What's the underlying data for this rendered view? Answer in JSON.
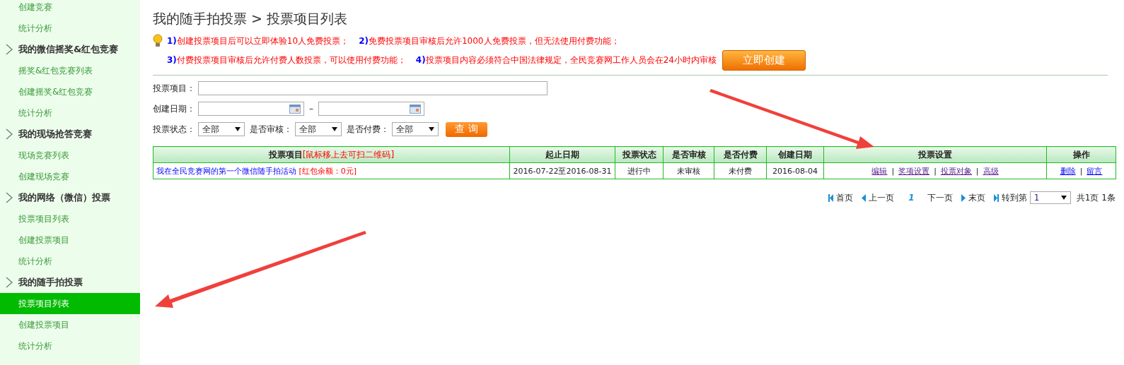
{
  "sidebar": {
    "items": [
      {
        "kind": "item",
        "label": "创建竞赛",
        "selected": false
      },
      {
        "kind": "item",
        "label": "统计分析",
        "selected": false
      },
      {
        "kind": "heading",
        "label": "我的微信摇奖&红包竞赛",
        "selected": false
      },
      {
        "kind": "item",
        "label": "摇奖&红包竞赛列表",
        "selected": false
      },
      {
        "kind": "item",
        "label": "创建摇奖&红包竞赛",
        "selected": false
      },
      {
        "kind": "item",
        "label": "统计分析",
        "selected": false
      },
      {
        "kind": "heading",
        "label": "我的现场抢答竞赛",
        "selected": false
      },
      {
        "kind": "item",
        "label": "现场竞赛列表",
        "selected": false
      },
      {
        "kind": "item",
        "label": "创建现场竞赛",
        "selected": false
      },
      {
        "kind": "heading",
        "label": "我的网络（微信）投票",
        "selected": false
      },
      {
        "kind": "item",
        "label": "投票项目列表",
        "selected": false
      },
      {
        "kind": "item",
        "label": "创建投票项目",
        "selected": false
      },
      {
        "kind": "item",
        "label": "统计分析",
        "selected": false
      },
      {
        "kind": "heading",
        "label": "我的随手拍投票",
        "selected": false
      },
      {
        "kind": "item",
        "label": "投票项目列表",
        "selected": true
      },
      {
        "kind": "item",
        "label": "创建投票项目",
        "selected": false
      },
      {
        "kind": "item",
        "label": "统计分析",
        "selected": false
      }
    ]
  },
  "page_title": "我的随手拍投票 > 投票项目列表",
  "tips": {
    "lines": [
      [
        {
          "number": "1)",
          "text": "创建投票项目后可以立即体验10人免费投票；"
        },
        {
          "number": "2)",
          "text": "免费投票项目审核后允许1000人免费投票，但无法使用付费功能；"
        }
      ],
      [
        {
          "number": "3)",
          "text": "付费投票项目审核后允许付费人数投票，可以使用付费功能；"
        },
        {
          "number": "4)",
          "text": "投票项目内容必须符合中国法律规定，全民竞赛网工作人员会在24小时内审核"
        }
      ]
    ],
    "create_button": "立即创建"
  },
  "filters": {
    "project_label": "投票项目：",
    "date_label": "创建日期：",
    "date_separator": "–",
    "selects": [
      {
        "label": "投票状态：",
        "value": "全部"
      },
      {
        "label": "是否审核：",
        "value": "全部"
      },
      {
        "label": "是否付费：",
        "value": "全部"
      }
    ],
    "query_button": "查 询"
  },
  "table": {
    "link_separator": "|",
    "columns": [
      {
        "label": "投票项目",
        "note": "[鼠标移上去可扫二维码]"
      },
      {
        "label": "起止日期"
      },
      {
        "label": "投票状态"
      },
      {
        "label": "是否审核"
      },
      {
        "label": "是否付费"
      },
      {
        "label": "创建日期"
      },
      {
        "label": "投票设置"
      },
      {
        "label": "操作"
      }
    ],
    "rows": [
      {
        "title": "我在全民竞赛网的第一个微信随手拍活动",
        "note": "[红包余额：0元]",
        "dates": "2016-07-22至2016-08-31",
        "status": "进行中",
        "audit": "未审核",
        "paid": "未付费",
        "created": "2016-08-04",
        "settings": [
          {
            "label": "编辑",
            "visited": true
          },
          {
            "label": "奖项设置",
            "visited": true
          },
          {
            "label": "投票对象",
            "visited": true
          },
          {
            "label": "高级",
            "visited": true
          }
        ],
        "actions": [
          {
            "label": "删除",
            "visited": false
          },
          {
            "label": "留言",
            "visited": false
          }
        ]
      }
    ]
  },
  "pagination": {
    "first": "首页",
    "prev": "上一页",
    "current": "1",
    "next": "下一页",
    "last": "末页",
    "goto_label": "转到第",
    "page_select": "1",
    "total_pages": "共1页",
    "total_items": "1条"
  }
}
